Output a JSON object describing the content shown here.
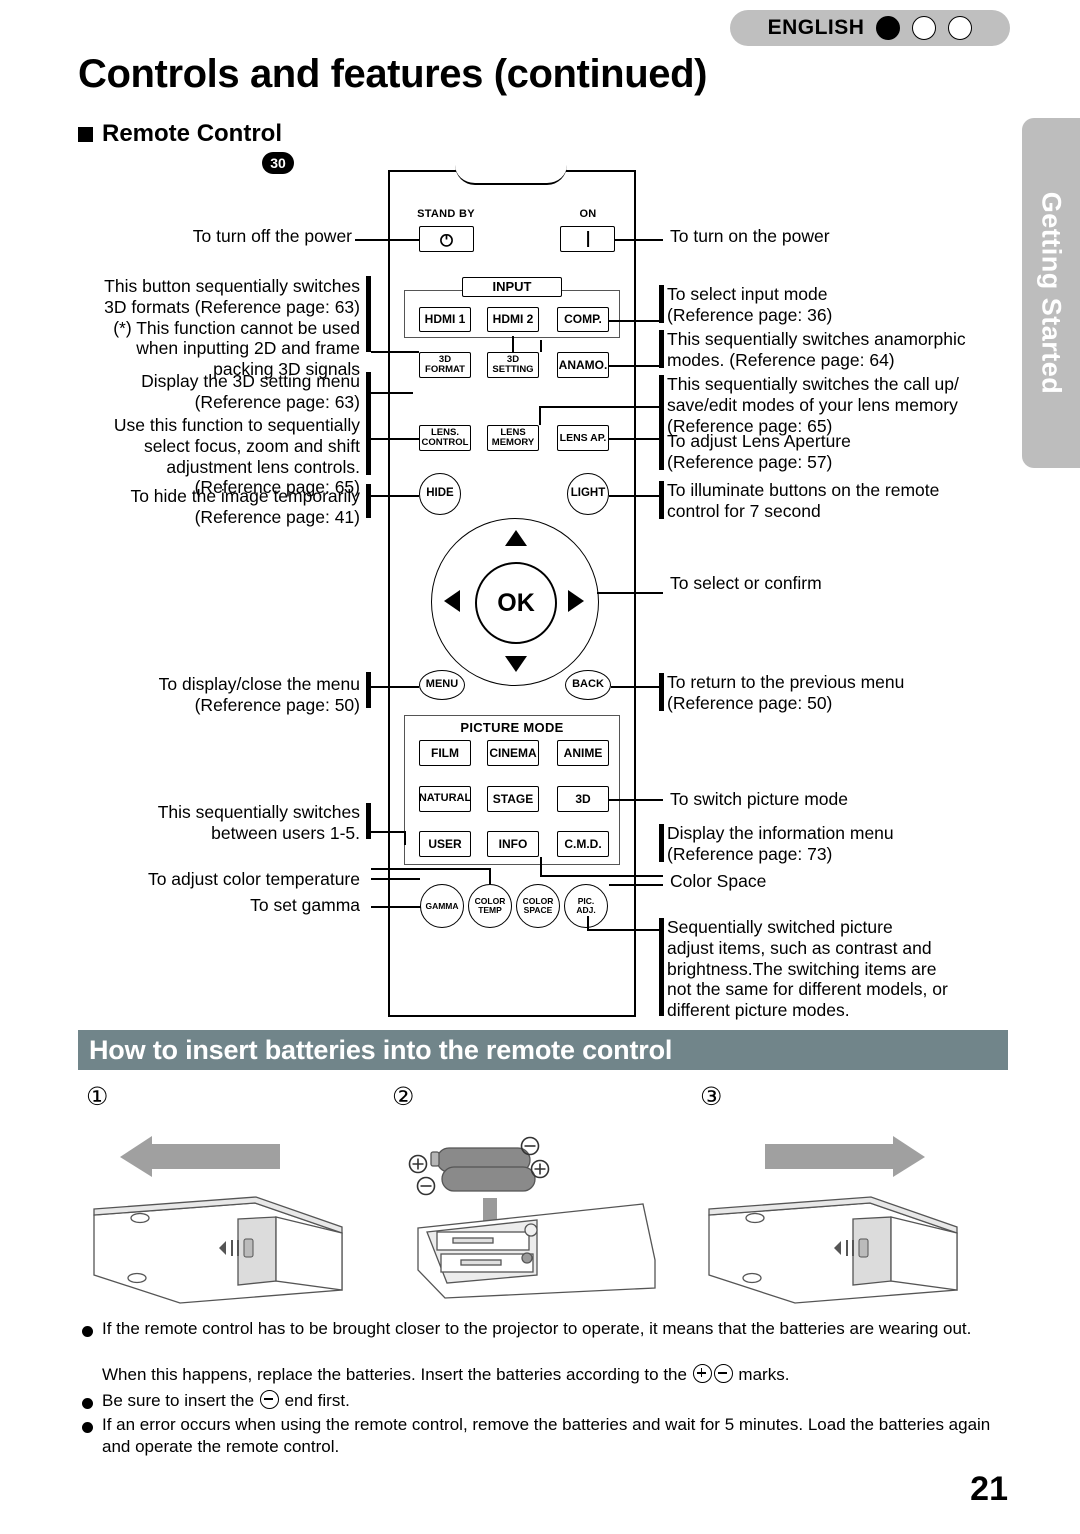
{
  "header": {
    "language": "ENGLISH",
    "indicator_dots": [
      "filled",
      "hollow",
      "hollow"
    ],
    "page_title": "Controls and features (continued)",
    "section_title": "Remote Control",
    "model_badge": "30",
    "side_tab": "Getting Started"
  },
  "remote": {
    "caption_standby": "STAND BY",
    "caption_on": "ON",
    "group_input": "INPUT",
    "group_picture_mode": "PICTURE MODE",
    "ok_label": "OK",
    "buttons": {
      "hdmi1": "HDMI 1",
      "hdmi2": "HDMI 2",
      "comp": "COMP.",
      "format3d_l1": "3D",
      "format3d_l2": "FORMAT",
      "setting3d_l1": "3D",
      "setting3d_l2": "SETTING",
      "anamo": "ANAMO.",
      "lens_control_l1": "LENS.",
      "lens_control_l2": "CONTROL",
      "lens_memory_l1": "LENS",
      "lens_memory_l2": "MEMORY",
      "lens_ap": "LENS AP.",
      "hide": "HIDE",
      "light": "LIGHT",
      "menu": "MENU",
      "back": "BACK",
      "film": "FILM",
      "cinema": "CINEMA",
      "anime": "ANIME",
      "natural": "NATURAL",
      "stage": "STAGE",
      "three_d": "3D",
      "user": "USER",
      "info": "INFO",
      "cmd": "C.M.D.",
      "gamma": "GAMMA",
      "color_temp_l1": "COLOR",
      "color_temp_l2": "TEMP",
      "color_space_l1": "COLOR",
      "color_space_l2": "SPACE",
      "pic_adj_l1": "PIC.",
      "pic_adj_l2": "ADJ."
    }
  },
  "annotations_left": {
    "power_off": "To turn off the power",
    "format_3d": "This button sequentially switches\n3D formats (Reference page: 63)\n(*) This function cannot be used\nwhen inputting 2D and frame\npacking 3D signals",
    "setting_3d": "Display the 3D setting menu\n(Reference page: 63)",
    "lens_control": "Use this function to sequentially\nselect focus, zoom and shift\nadjustment lens controls.\n(Reference page: 65)",
    "hide": "To hide the image temporarily\n(Reference page: 41)",
    "menu": "To display/close the menu\n(Reference page: 50)",
    "user": "This sequentially switches\nbetween users 1-5.",
    "color_temp": "To adjust color temperature",
    "gamma": "To set gamma"
  },
  "annotations_right": {
    "power_on": "To turn on the power",
    "input": "To select input mode\n(Reference page: 36)",
    "anamo": "This sequentially switches anamorphic\nmodes. (Reference page: 64)",
    "lens_memory": "This sequentially switches the call up/\nsave/edit modes of your lens memory\n(Reference page: 65)",
    "lens_ap": "To adjust Lens Aperture\n(Reference page: 57)",
    "light": "To illuminate buttons on the remote\ncontrol for 7 second",
    "ok": "To select or confirm",
    "back": "To return to the previous menu\n(Reference page: 50)",
    "picture_mode": "To switch picture mode",
    "info": "Display the information menu\n(Reference page: 73)",
    "color_space": "Color Space",
    "pic_adj": "Sequentially switched picture\nadjust items, such as contrast and\nbrightness.The switching items are\nnot the same for different models, or\ndifferent picture modes."
  },
  "battery": {
    "heading": "How to insert batteries into the remote control",
    "steps": [
      "①",
      "②",
      "③"
    ],
    "notes": [
      "If the remote control has to be brought closer to the projector to operate, it means that the batteries are wearing out.",
      "When this happens, replace the batteries. Insert the batteries according to the  marks.",
      "Be sure to insert the  end first.",
      "If an error occurs when using the remote control, remove the batteries and wait for 5 minutes. Load the batteries again and operate the remote control."
    ]
  },
  "page_number": "21",
  "colors": {
    "tab_gray": "#bdbdbd",
    "header_bar": "#71858a",
    "pill_gray": "#bfbfbf",
    "battery_gray": "#8a8a8a"
  }
}
